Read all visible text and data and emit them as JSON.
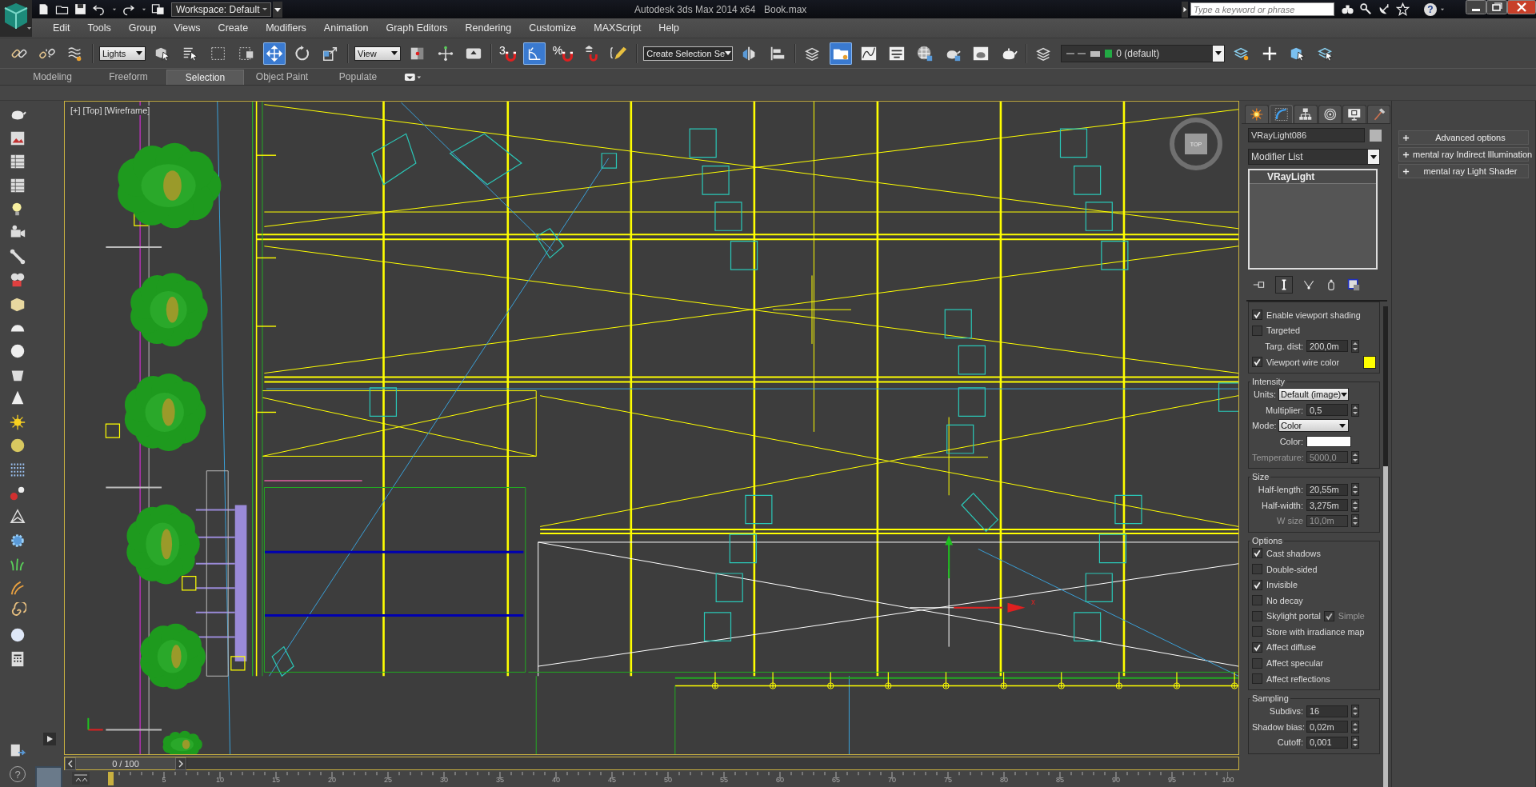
{
  "title_bar": {
    "workspace": "Workspace: Default",
    "title": "Autodesk 3ds Max  2014 x64",
    "file": "Book.max",
    "search_placeholder": "Type a keyword or phrase",
    "help": "?"
  },
  "menu": [
    "Edit",
    "Tools",
    "Group",
    "Views",
    "Create",
    "Modifiers",
    "Animation",
    "Graph Editors",
    "Rendering",
    "Customize",
    "MAXScript",
    "Help"
  ],
  "toolbar": [
    {
      "kind": "link",
      "selected": false
    },
    {
      "kind": "unlink",
      "selected": false
    },
    {
      "kind": "bind",
      "selected": false
    },
    {
      "kind": "dropdown",
      "value": "Lights"
    },
    {
      "kind": "select",
      "selected": false
    },
    {
      "kind": "select-name",
      "selected": false
    },
    {
      "kind": "rect-select",
      "selected": false
    },
    {
      "kind": "window-crossing",
      "selected": false
    },
    {
      "kind": "move",
      "selected": true
    },
    {
      "kind": "rotate",
      "selected": false
    },
    {
      "kind": "scale",
      "selected": false
    },
    {
      "kind": "dropdown",
      "value": "View"
    },
    {
      "kind": "pivot",
      "selected": false
    },
    {
      "kind": "manipulate",
      "selected": false
    },
    {
      "kind": "keyboard",
      "selected": false
    },
    {
      "kind": "snap",
      "label": "3",
      "selected": false
    },
    {
      "kind": "angle-snap",
      "selected": true
    },
    {
      "kind": "snap",
      "label": "%",
      "selected": false
    },
    {
      "kind": "spinner-snap",
      "selected": false
    },
    {
      "kind": "edit-named",
      "selected": false
    },
    {
      "kind": "dropdown",
      "value": "Create Selection Se"
    },
    {
      "kind": "mirror",
      "selected": false
    },
    {
      "kind": "align",
      "selected": false
    },
    {
      "kind": "layers",
      "selected": false
    },
    {
      "kind": "scene-explorer",
      "selected": true
    },
    {
      "kind": "curve-editor",
      "selected": false
    },
    {
      "kind": "schematic",
      "selected": false
    },
    {
      "kind": "material",
      "selected": false
    },
    {
      "kind": "render-setup",
      "selected": false
    },
    {
      "kind": "render-frame",
      "selected": false
    },
    {
      "kind": "render",
      "selected": false
    },
    {
      "kind": "layers",
      "selected": false
    },
    {
      "kind": "layer-dropdown",
      "value": "0 (default)"
    },
    {
      "kind": "new-layer",
      "selected": false
    },
    {
      "kind": "plus",
      "selected": false
    },
    {
      "kind": "select-in-layer",
      "selected": false
    },
    {
      "kind": "layer-select",
      "selected": false
    }
  ],
  "ribbon_tabs": [
    {
      "label": "Modeling",
      "selected": false
    },
    {
      "label": "Freeform",
      "selected": false
    },
    {
      "label": "Selection",
      "selected": true
    },
    {
      "label": "Object Paint",
      "selected": false
    },
    {
      "label": "Populate",
      "selected": false
    }
  ],
  "viewport": {
    "label": "[+] [Top] [Wireframe]",
    "viewcube": "TOP",
    "gizmo_axis": "x"
  },
  "left_help": "?",
  "command_panel": {
    "tabs": [
      {
        "kind": "create",
        "selected": false
      },
      {
        "kind": "modify",
        "selected": true
      },
      {
        "kind": "hierarchy",
        "selected": false
      },
      {
        "kind": "motion",
        "selected": false
      },
      {
        "kind": "display",
        "selected": false
      },
      {
        "kind": "utilities",
        "selected": false
      }
    ],
    "object_name": "VRayLight086",
    "modifier_list": "Modifier List",
    "stack": [
      "VRayLight"
    ],
    "groups": [
      {
        "rows": [
          {
            "kind": "check",
            "label": "Enable viewport shading",
            "checked": true
          },
          {
            "kind": "check",
            "label": "Targeted",
            "checked": false
          },
          {
            "kind": "spinner",
            "label": "Targ. dist:",
            "value": "200,0m",
            "disabled": false
          },
          {
            "kind": "color-check",
            "label": "Viewport wire color",
            "checked": true,
            "color": "#ffff00"
          }
        ]
      },
      {
        "title": "Intensity",
        "rows": [
          {
            "kind": "dropdown",
            "label": "Units:",
            "value": "Default (image)"
          },
          {
            "kind": "spinner",
            "label": "Multiplier:",
            "value": "0,5",
            "disabled": false
          },
          {
            "kind": "dropdown",
            "label": "Mode:",
            "value": "Color"
          },
          {
            "kind": "color",
            "label": "Color:",
            "color": "#ffffff"
          },
          {
            "kind": "spinner",
            "label": "Temperature:",
            "value": "5000,0",
            "disabled": true
          }
        ]
      },
      {
        "title": "Size",
        "rows": [
          {
            "kind": "spinner",
            "label": "Half-length:",
            "value": "20,55m",
            "disabled": false
          },
          {
            "kind": "spinner",
            "label": "Half-width:",
            "value": "3,275m",
            "disabled": false
          },
          {
            "kind": "spinner",
            "label": "W size",
            "value": "10,0m",
            "disabled": true
          }
        ]
      },
      {
        "title": "Options",
        "rows": [
          {
            "kind": "check",
            "label": "Cast shadows",
            "checked": true
          },
          {
            "kind": "check",
            "label": "Double-sided",
            "checked": false
          },
          {
            "kind": "check",
            "label": "Invisible",
            "checked": true
          },
          {
            "kind": "check",
            "label": "No decay",
            "checked": false
          },
          {
            "kind": "check-pair",
            "label": "Skylight portal",
            "checked": false,
            "sub_label": "Simple",
            "sub_checked": true
          },
          {
            "kind": "check",
            "label": "Store with irradiance map",
            "checked": false
          },
          {
            "kind": "check",
            "label": "Affect diffuse",
            "checked": true
          },
          {
            "kind": "check",
            "label": "Affect specular",
            "checked": false
          },
          {
            "kind": "check",
            "label": "Affect reflections",
            "checked": false
          }
        ]
      },
      {
        "title": "Sampling",
        "rows": [
          {
            "kind": "spinner",
            "label": "Subdivs:",
            "value": "16",
            "disabled": false
          },
          {
            "kind": "spinner",
            "label": "Shadow bias:",
            "value": "0,02m",
            "disabled": false
          },
          {
            "kind": "spinner",
            "label": "Cutoff:",
            "value": "0,001",
            "disabled": false
          }
        ]
      }
    ]
  },
  "rollouts": [
    "Advanced options",
    "mental ray Indirect Illumination",
    "mental ray Light Shader"
  ],
  "timeline": {
    "slider": "0 / 100",
    "ticks": [
      "5",
      "10",
      "15",
      "20",
      "25",
      "30",
      "35",
      "40",
      "45",
      "50",
      "55",
      "60",
      "65",
      "70",
      "75",
      "80",
      "85",
      "90",
      "95",
      "100"
    ]
  }
}
